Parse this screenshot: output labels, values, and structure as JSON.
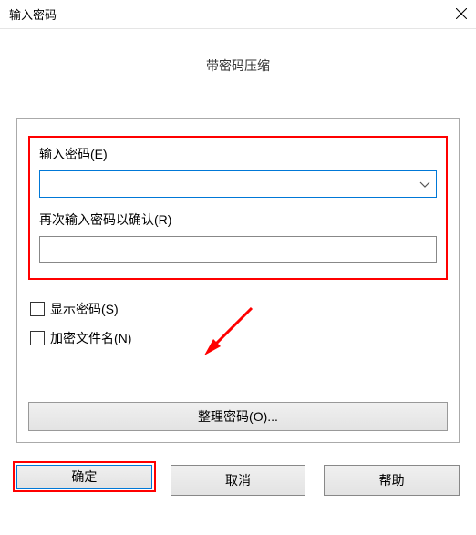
{
  "window": {
    "title": "输入密码",
    "subtitle": "带密码压缩"
  },
  "form": {
    "enter_pw_label": "输入密码(E)",
    "reenter_pw_label": "再次输入密码以确认(R)",
    "show_pw_label": "显示密码(S)",
    "encrypt_name_label": "加密文件名(N)",
    "manage_pw_button": "整理密码(O)..."
  },
  "buttons": {
    "ok": "确定",
    "cancel": "取消",
    "help": "帮助"
  },
  "annotation_colors": {
    "highlight": "#ff0000"
  }
}
